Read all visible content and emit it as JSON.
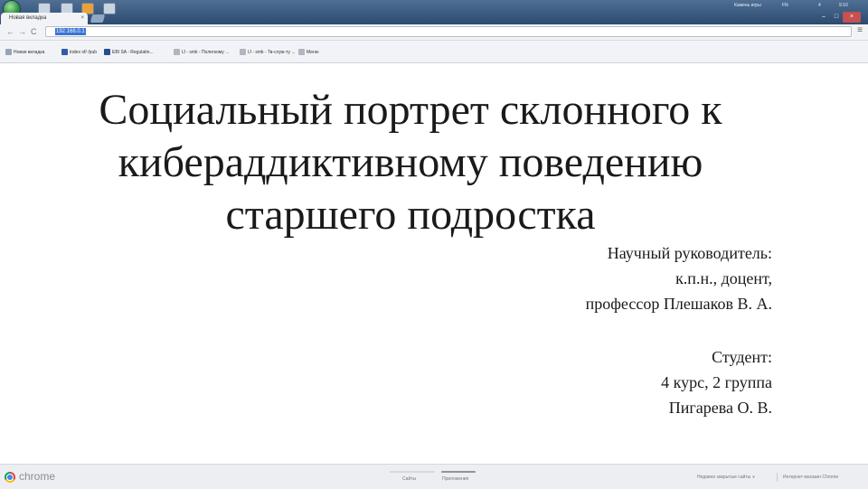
{
  "browser": {
    "tab_title": "Новая вкладка",
    "tab_close": "×",
    "url": "192.168.0.1",
    "tray": {
      "user": "Камень игры",
      "lang": "FN",
      "counter": "4",
      "time": "9:10"
    },
    "window_buttons": {
      "minimize": "–",
      "maximize": "□",
      "close": "×"
    },
    "nav": {
      "back": "←",
      "forward": "→",
      "reload": "C"
    },
    "menu_icon": "≡"
  },
  "bookmarks": [
    {
      "label": "Новая вкладка",
      "color": "#9aa4b1"
    },
    {
      "label": "index of/ /pub",
      "color": "#2c5fa8"
    },
    {
      "label": "EBI SA - Regulatin...",
      "color": "#2a4c8c"
    },
    {
      "label": "IJ - smk - Полегкому ...",
      "color": "#b0b6bf"
    },
    {
      "label": "IJ - smk - Тв-служ-ту ...",
      "color": "#b0b6bf"
    },
    {
      "label": "Меню",
      "color": "#b0b6bf"
    }
  ],
  "slide": {
    "title_lines": [
      "Социальный портрет склонного к",
      "кибераддиктивному поведению",
      "старшего подростка"
    ],
    "supervisor": [
      "Научный руководитель:",
      "к.п.н., доцент,",
      "профессор Плешаков В. А."
    ],
    "student": [
      "Студент:",
      "4 курс, 2 группа",
      "Пигарева О. В."
    ]
  },
  "bottom_bar": {
    "chrome_label": "chrome",
    "pages": [
      {
        "label": "Сайты",
        "active": false
      },
      {
        "label": "Приложения",
        "active": true
      }
    ],
    "closed_sites": "Недавно закрытые сайты ∨",
    "web_store": "Интернет-магазин Chrome"
  },
  "colors": {
    "taskbar": "#3d5b82",
    "chrome_bg": "#f1f3f6",
    "url_highlight": "#3a74d6",
    "slide_text": "#1a1a1a"
  }
}
